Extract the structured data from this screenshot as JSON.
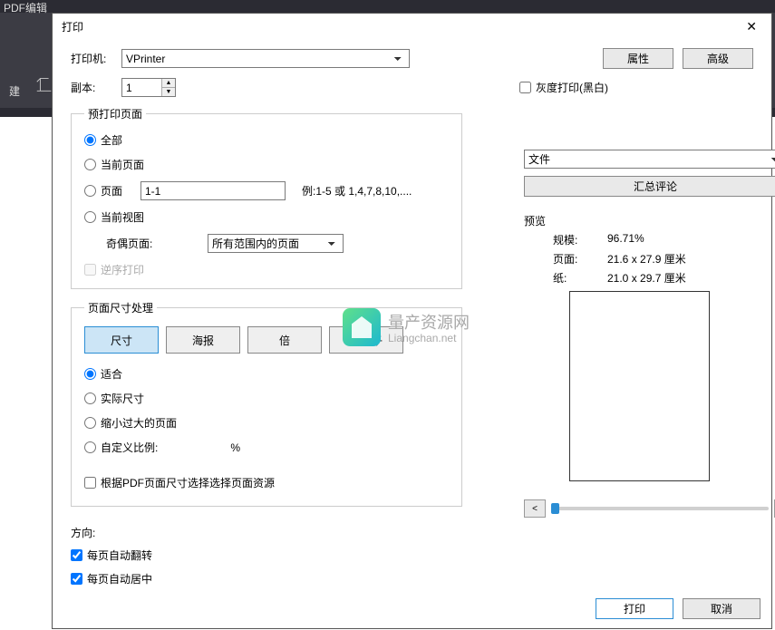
{
  "bg": {
    "app": "PDF编辑",
    "create": "建"
  },
  "title": "打印",
  "printer": {
    "label": "打印机:",
    "selected": "VPrinter",
    "props_btn": "属性",
    "adv_btn": "高级"
  },
  "copies": {
    "label": "副本:",
    "value": "1"
  },
  "grayscale_label": "灰度打印(黑白)",
  "pre": {
    "legend": "预打印页面",
    "all": "全部",
    "current": "当前页面",
    "pages": "页面",
    "range_value": "1-1",
    "example": "例:1-5 或 1,4,7,8,10,....",
    "view": "当前视图",
    "subset_label": "奇偶页面:",
    "subset_value": "所有范围内的页面",
    "reverse": "逆序打印"
  },
  "sizing": {
    "legend": "页面尺寸处理",
    "tabs": {
      "size": "尺寸",
      "poster": "海报",
      "multi": "倍",
      "booklet": "小册子"
    },
    "fit": "适合",
    "actual": "实际尺寸",
    "shrink": "缩小过大的页面",
    "custom": "自定义比例:",
    "pct": "%",
    "pdf_source": "根据PDF页面尺寸选择选择页面资源"
  },
  "orient": {
    "label": "方向:",
    "auto_rotate": "每页自动翻转",
    "auto_center": "每页自动居中"
  },
  "preview": {
    "file": "文件",
    "summarize": "汇总评论",
    "label": "预览",
    "scale_k": "规模:",
    "scale_v": "96.71%",
    "page_k": "页面:",
    "page_v": "21.6 x 27.9 厘米",
    "paper_k": "纸:",
    "paper_v": "21.0 x 29.7 厘米"
  },
  "footer": {
    "print": "打印",
    "cancel": "取消"
  },
  "watermark": {
    "cn": "量产资源网",
    "en": "Liangchan.net"
  }
}
